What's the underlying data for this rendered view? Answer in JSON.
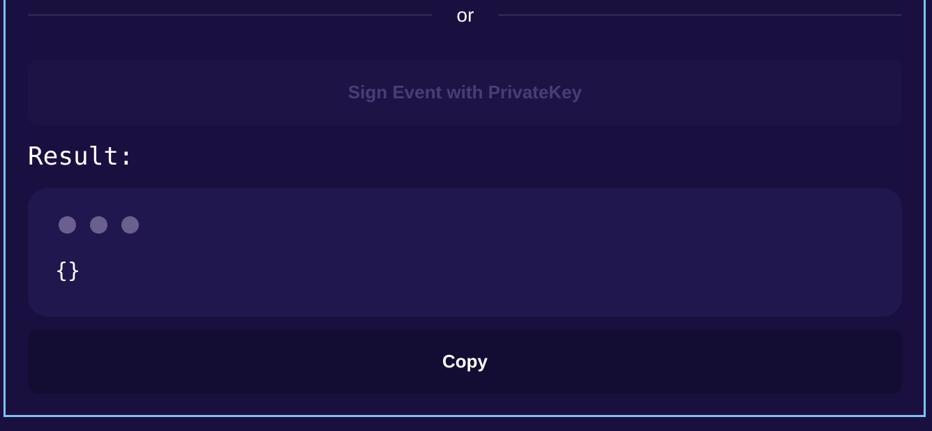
{
  "divider": {
    "text": "or"
  },
  "sign_button": {
    "label": "Sign Event with PrivateKey",
    "state": "disabled"
  },
  "result": {
    "label": "Result:",
    "code": "{}"
  },
  "copy_button": {
    "label": "Copy"
  },
  "colors": {
    "background": "#1a1040",
    "frame_border": "#7cc3f2",
    "panel": "#1f174d",
    "disabled_text": "#4a3d76",
    "dot": "#6a5f8e"
  }
}
